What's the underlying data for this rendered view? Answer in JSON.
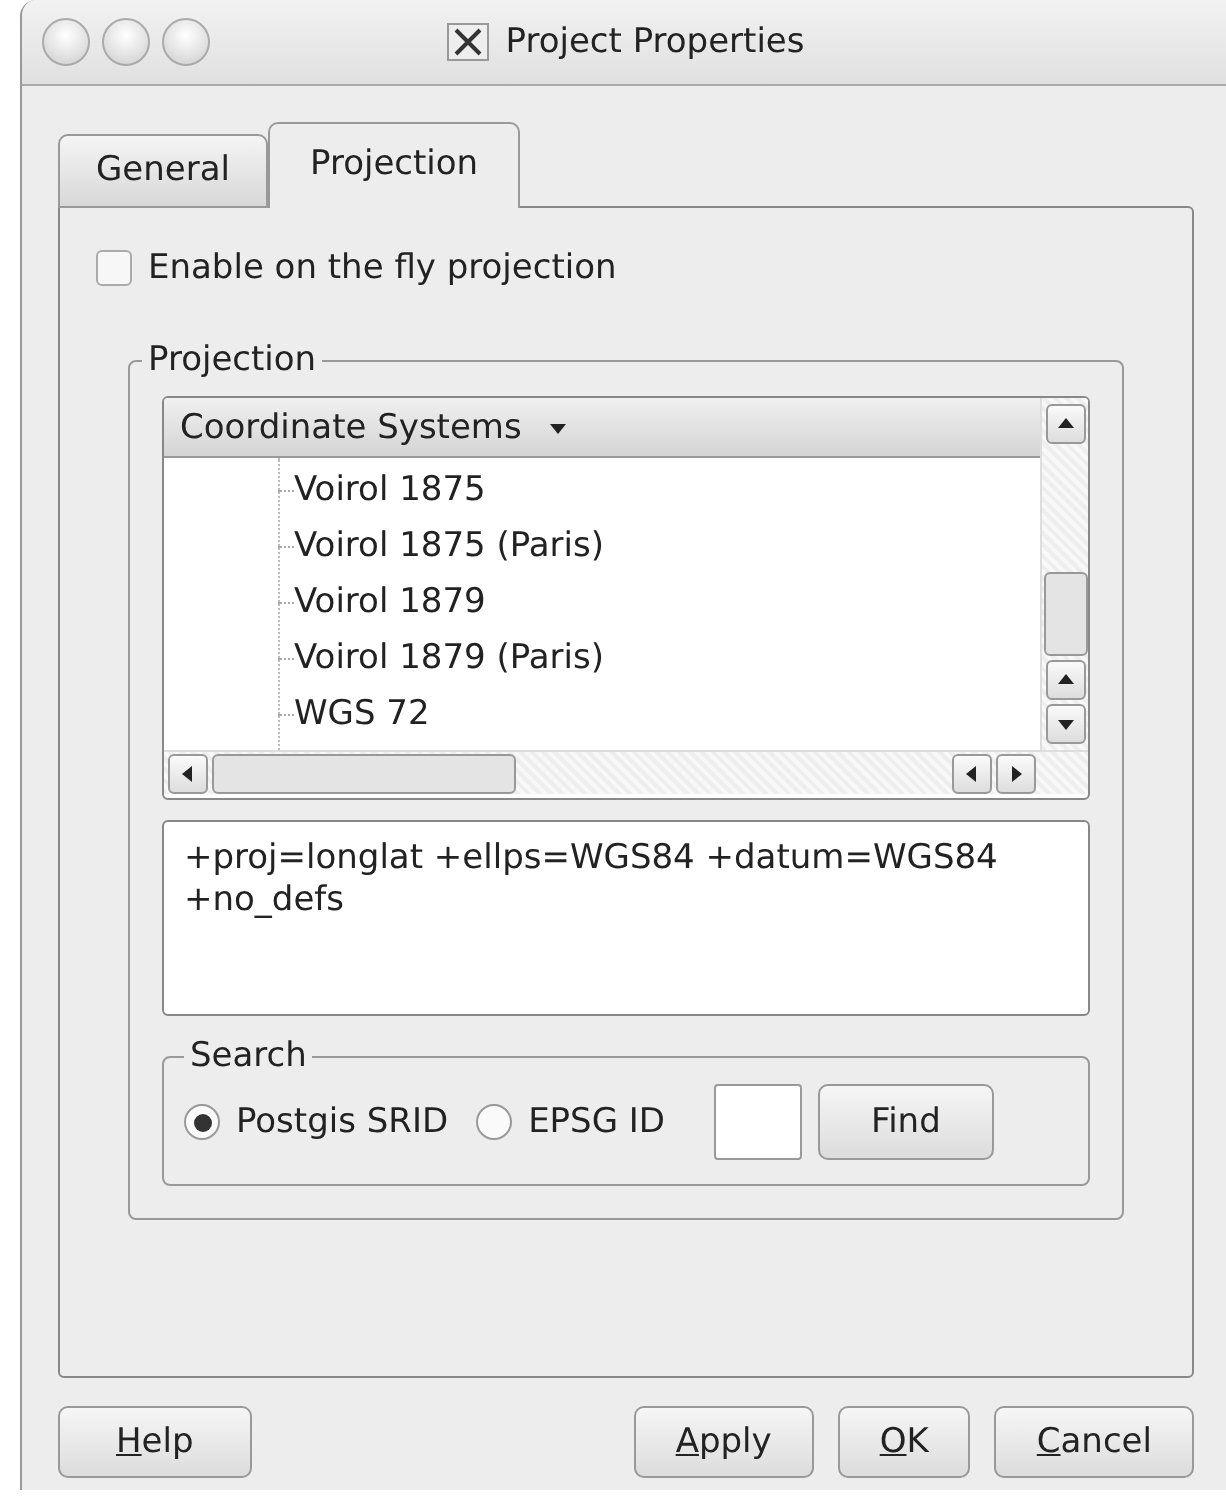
{
  "window": {
    "title": "Project Properties"
  },
  "tabs": [
    {
      "label": "General",
      "selected": false
    },
    {
      "label": "Projection",
      "selected": true
    }
  ],
  "fly_projection": {
    "label": "Enable on the fly projection",
    "checked": false
  },
  "projection_group": {
    "title": "Projection",
    "tree_header": "Coordinate Systems",
    "items": [
      "Voirol 1875",
      "Voirol 1875 (Paris)",
      "Voirol 1879",
      "Voirol 1879 (Paris)",
      "WGS 72"
    ],
    "proj_string": "+proj=longlat +ellps=WGS84 +datum=WGS84 +no_defs"
  },
  "search_group": {
    "title": "Search",
    "options": [
      {
        "label": "Postgis SRID",
        "selected": true
      },
      {
        "label": "EPSG ID",
        "selected": false
      }
    ],
    "find_label": "Find"
  },
  "buttons": [
    {
      "mnemonic": "H",
      "rest": "elp"
    },
    {
      "mnemonic": "A",
      "rest": "pply"
    },
    {
      "mnemonic": "O",
      "rest": "K"
    },
    {
      "mnemonic": "C",
      "rest": "ancel"
    }
  ]
}
